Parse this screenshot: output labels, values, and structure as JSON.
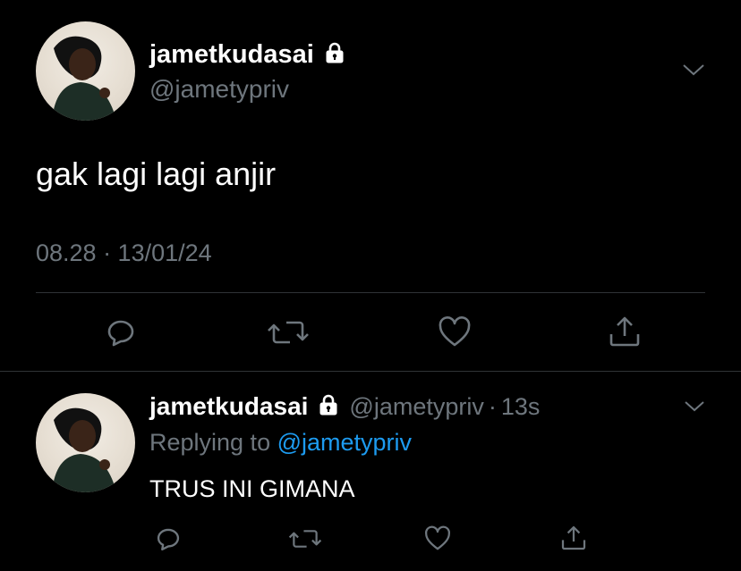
{
  "main_tweet": {
    "display_name": "jametkudasai",
    "handle": "@jametypriv",
    "text": "gak lagi lagi anjir",
    "timestamp": "08.28 · 13/01/24",
    "protected": true
  },
  "reply": {
    "display_name": "jametkudasai",
    "handle": "@jametypriv",
    "separator": "·",
    "time": "13s",
    "replying_prefix": "Replying to",
    "replying_handle": "@jametypriv",
    "text": "TRUS INI GIMANA",
    "protected": true
  },
  "icons": {
    "reply": "reply-icon",
    "retweet": "retweet-icon",
    "like": "heart-icon",
    "share": "share-icon",
    "menu": "chevron-down-icon",
    "protected": "lock-icon"
  },
  "colors": {
    "background": "#000000",
    "text": "#ffffff",
    "muted": "#6e767d",
    "link": "#1d9bf0",
    "divider": "#2f3336"
  }
}
